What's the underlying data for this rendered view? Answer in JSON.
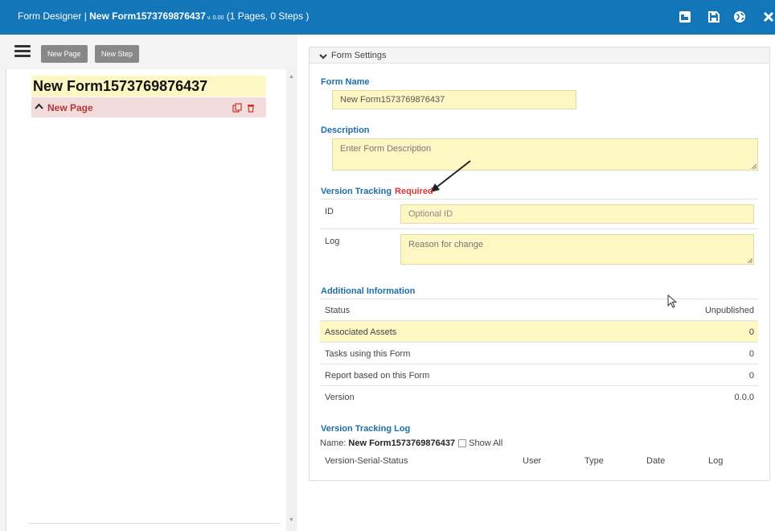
{
  "window": {
    "title_prefix": "Form Designer | ",
    "form_name": "New Form1573769876437",
    "version_label": " v. 0.00",
    "title_suffix": " (1 Pages, 0 Steps )"
  },
  "toolbar": {
    "icons": [
      "steps-diagram-icon",
      "save-icon",
      "globe-icon",
      "close-icon"
    ]
  },
  "left": {
    "new_page_label": "New Page",
    "new_step_label": "New Step",
    "tree": {
      "form_title": "New Form1573769876437",
      "pages": [
        {
          "label": "New Page"
        }
      ]
    }
  },
  "settings": {
    "header_label": "Form Settings",
    "form_name_label": "Form Name",
    "form_name_value": "New Form1573769876437",
    "description_label": "Description",
    "description_placeholder": "Enter Form Description",
    "version_tracking_label": "Version Tracking",
    "required_label": "Required",
    "id_label": "ID",
    "id_placeholder": "Optional ID",
    "log_label": "Log",
    "log_placeholder": "Reason for change",
    "additional_info_label": "Additional Information",
    "info_rows": [
      {
        "key": "Status",
        "value": "Unpublished"
      },
      {
        "key": "Associated Assets",
        "value": "0"
      },
      {
        "key": "Tasks using this Form",
        "value": "0"
      },
      {
        "key": "Report based on this Form",
        "value": "0"
      },
      {
        "key": "Version",
        "value": "0.0.0"
      }
    ],
    "tracking_log_label": "Version Tracking Log",
    "log_name_prefix": "Name:",
    "log_name_value": "New Form1573769876437",
    "show_all_label": "Show All",
    "show_all_checked": false,
    "log_columns": [
      "Version-Serial-Status",
      "User",
      "Type",
      "Date",
      "Log"
    ]
  },
  "colors": {
    "topbar": "#1376b8",
    "section_heading": "#1b6fa8",
    "required": "#dd3333",
    "input_bg": "#fdf7c3",
    "page_row_bg": "#f3dcdc",
    "page_row_text": "#b5363a"
  }
}
